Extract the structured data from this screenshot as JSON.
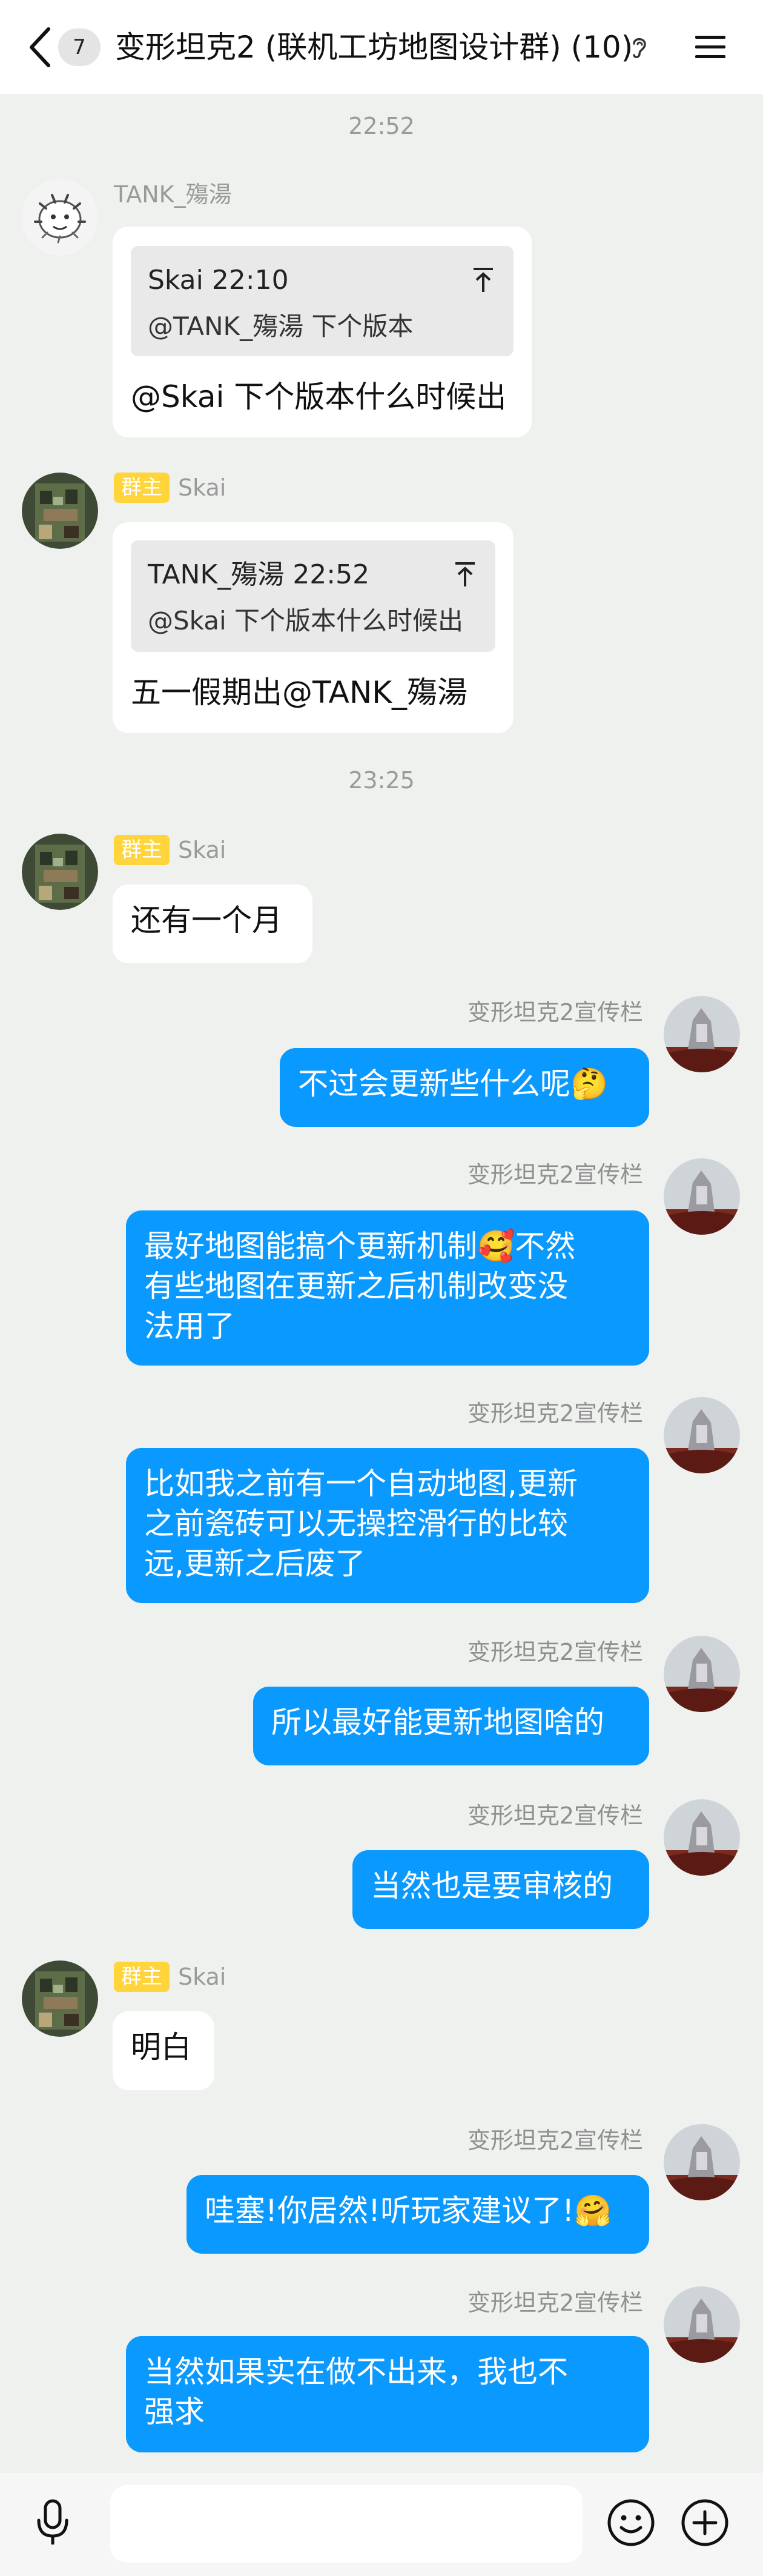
{
  "header": {
    "badge_count": "7",
    "title": "变形坦克2 (联机工坊地图设计群) (10)"
  },
  "timestamps": [
    "22:52",
    "23:25"
  ],
  "messages": [
    {
      "sender": "TANK_殤湯",
      "quote": {
        "header": "Skai 22:10",
        "text": "@TANK_殤湯 下个版本"
      },
      "text": "@Skai 下个版本什么时候出"
    },
    {
      "sender_tag": "群主",
      "sender": "Skai",
      "quote": {
        "header": "TANK_殤湯 22:52",
        "text": "@Skai 下个版本什么时候出"
      },
      "text": "五一假期出@TANK_殤湯"
    },
    {
      "sender_tag": "群主",
      "sender": "Skai",
      "text": "还有一个月"
    },
    {
      "sender": "变形坦克2宣传栏",
      "text": "不过会更新些什么呢🤔"
    },
    {
      "sender": "变形坦克2宣传栏",
      "lines": [
        "最好地图能搞个更新机制🥰不然",
        "有些地图在更新之后机制改变没",
        "法用了"
      ]
    },
    {
      "sender": "变形坦克2宣传栏",
      "lines": [
        "比如我之前有一个自动地图,更新",
        "之前瓷砖可以无操控滑行的比较",
        "远,更新之后废了"
      ]
    },
    {
      "sender": "变形坦克2宣传栏",
      "text": "所以最好能更新地图啥的"
    },
    {
      "sender": "变形坦克2宣传栏",
      "text": "当然也是要审核的"
    },
    {
      "sender_tag": "群主",
      "sender": "Skai",
      "text": "明白"
    },
    {
      "sender": "变形坦克2宣传栏",
      "text": "哇塞!你居然!听玩家建议了!🤗"
    },
    {
      "sender": "变形坦克2宣传栏",
      "lines": [
        "当然如果实在做不出来，我也不",
        "强求"
      ]
    }
  ],
  "input": {
    "placeholder": ""
  },
  "icons": {
    "back": "back-arrow-icon",
    "ear": "ear-icon",
    "menu": "menu-icon",
    "mic": "mic-icon",
    "emoji": "emoji-icon",
    "plus": "plus-icon"
  },
  "colors": {
    "background": "#eef1ee",
    "bubble_self": "#0a99ff",
    "bubble_other": "#ffffff",
    "owner_tag": "#ffd53b"
  }
}
